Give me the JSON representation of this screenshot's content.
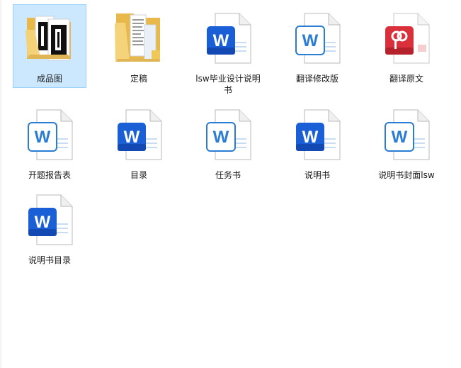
{
  "files": [
    {
      "label": "成品图",
      "type": "folder-images",
      "selected": true
    },
    {
      "label": "定稿",
      "type": "folder-docs",
      "selected": false
    },
    {
      "label": "lsw毕业设计说明书",
      "type": "word",
      "selected": false
    },
    {
      "label": "翻译修改版",
      "type": "word-light",
      "selected": false
    },
    {
      "label": "翻译原文",
      "type": "pdf",
      "selected": false
    },
    {
      "label": "开题报告表",
      "type": "word-light",
      "selected": false
    },
    {
      "label": "目录",
      "type": "word",
      "selected": false
    },
    {
      "label": "任务书",
      "type": "word-light",
      "selected": false
    },
    {
      "label": "说明书",
      "type": "word",
      "selected": false
    },
    {
      "label": "说明书封面lsw",
      "type": "word-light",
      "selected": false
    },
    {
      "label": "说明书目录",
      "type": "word",
      "selected": false
    }
  ],
  "colors": {
    "selection_bg": "#cce8ff",
    "selection_border": "#99d1ff",
    "word_blue": "#185abd",
    "word_blue_light": "#2b7cd3",
    "pdf_red": "#d9303b",
    "folder_yellow": "#f4d37a"
  },
  "icons": {
    "word": "word-doc-icon",
    "pdf": "pdf-doc-icon",
    "folder": "folder-icon"
  }
}
